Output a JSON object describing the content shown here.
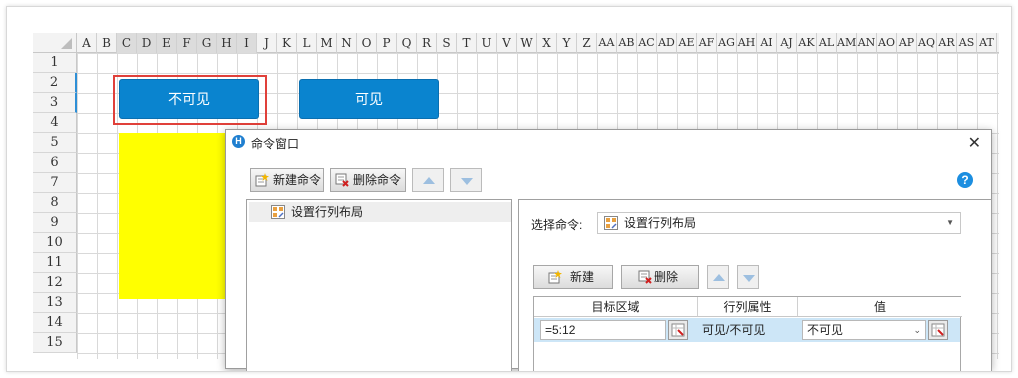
{
  "columns": [
    "A",
    "B",
    "C",
    "D",
    "E",
    "F",
    "G",
    "H",
    "I",
    "J",
    "K",
    "L",
    "M",
    "N",
    "O",
    "P",
    "Q",
    "R",
    "S",
    "T",
    "U",
    "V",
    "W",
    "X",
    "Y",
    "Z",
    "AA",
    "AB",
    "AC",
    "AD",
    "AE",
    "AF",
    "AG",
    "AH",
    "AI",
    "AJ",
    "AK",
    "AL",
    "AM",
    "AN",
    "AO",
    "AP",
    "AQ",
    "AR",
    "AS",
    "AT"
  ],
  "rows": [
    "1",
    "2",
    "3",
    "4",
    "5",
    "6",
    "7",
    "8",
    "9",
    "10",
    "11",
    "12",
    "13",
    "14",
    "15"
  ],
  "sheet_buttons": {
    "invisible_label": "不可见",
    "visible_label": "可见"
  },
  "dialog": {
    "title": "命令窗口",
    "new_command": "新建命令",
    "delete_command": "删除命令",
    "tree_item": "设置行列布局",
    "select_label": "选择命令:",
    "select_value": "设置行列布局",
    "new_label": "新建",
    "delete_label": "删除",
    "table": {
      "headers": [
        "目标区域",
        "行列属性",
        "值"
      ],
      "row": {
        "target": "=5:12",
        "property": "可见/不可见",
        "value": "不可见"
      }
    }
  },
  "colors": {
    "accent": "#0a84cf",
    "highlight": "#ffff00",
    "selection": "#e0403a"
  }
}
